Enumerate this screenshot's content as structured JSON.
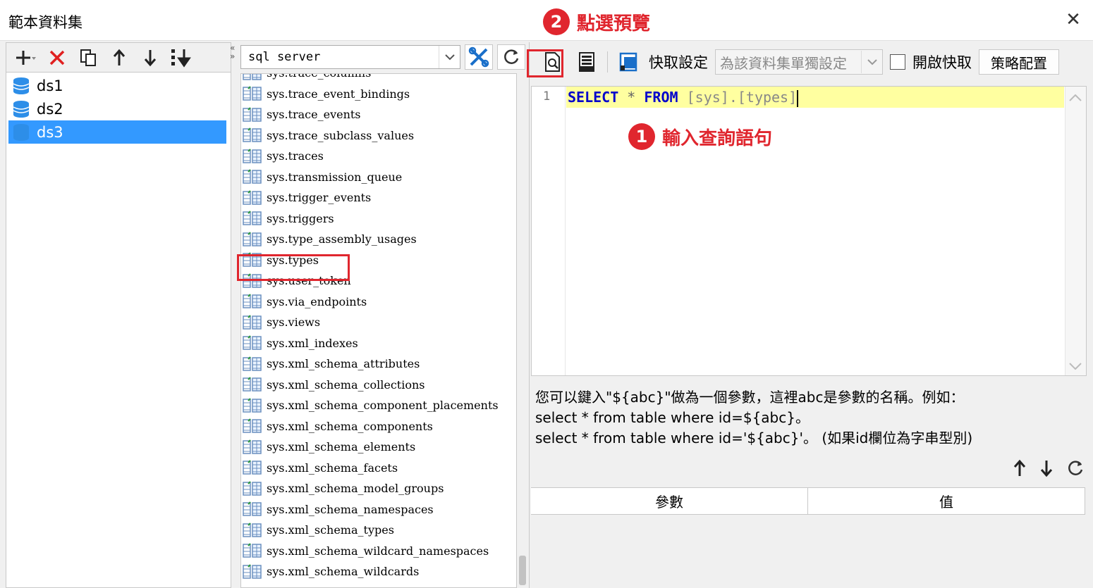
{
  "window": {
    "title": "範本資料集",
    "close_symbol": "✕"
  },
  "annotations": [
    {
      "number": "2",
      "text": "點選預覽"
    },
    {
      "number": "1",
      "text": "輸入查詢語句"
    }
  ],
  "datasets": [
    {
      "label": "ds1",
      "selected": false
    },
    {
      "label": "ds2",
      "selected": false
    },
    {
      "label": "ds3",
      "selected": true
    }
  ],
  "left_toolbar": {
    "icons": [
      "add-icon",
      "delete-icon",
      "copy-icon",
      "move-up-icon",
      "move-down-icon",
      "sort-icon"
    ]
  },
  "connection": {
    "selected": "sql server"
  },
  "tables": [
    "sys.trace_columns",
    "sys.trace_event_bindings",
    "sys.trace_events",
    "sys.trace_subclass_values",
    "sys.traces",
    "sys.transmission_queue",
    "sys.trigger_events",
    "sys.triggers",
    "sys.type_assembly_usages",
    "sys.types",
    "sys.user_token",
    "sys.via_endpoints",
    "sys.views",
    "sys.xml_indexes",
    "sys.xml_schema_attributes",
    "sys.xml_schema_collections",
    "sys.xml_schema_component_placements",
    "sys.xml_schema_components",
    "sys.xml_schema_elements",
    "sys.xml_schema_facets",
    "sys.xml_schema_model_groups",
    "sys.xml_schema_namespaces",
    "sys.xml_schema_types",
    "sys.xml_schema_wildcard_namespaces",
    "sys.xml_schema_wildcards"
  ],
  "right_toolbar": {
    "cache_label": "快取設定",
    "cache_select_value": "為該資料集單獨設定",
    "enable_cache_label": "開啟快取",
    "strategy_button": "策略配置"
  },
  "editor": {
    "line_number": "1",
    "kw_select": "SELECT",
    "star": "*",
    "kw_from": "FROM",
    "table_ref": "[sys].[types]"
  },
  "help": {
    "line1": "您可以鍵入\"${abc}\"做為一個參數，這裡abc是參數的名稱。例如：",
    "line2": "select * from table where id=${abc}。",
    "line3": "select * from table where id='${abc}'。 (如果id欄位為字串型別)"
  },
  "param_table": {
    "col_param": "參數",
    "col_value": "值"
  },
  "colors": {
    "accent": "#3399ff",
    "annotation": "#e0262e",
    "highlight_line": "#ffffa0"
  }
}
